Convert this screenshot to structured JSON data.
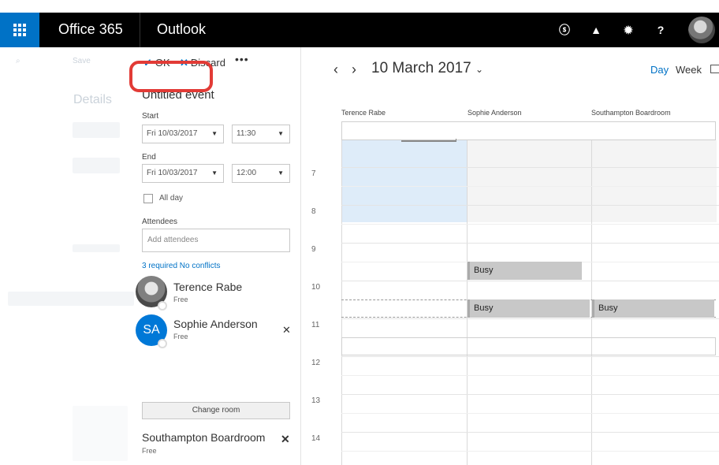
{
  "topbar": {
    "suite_title": "Office 365",
    "app_title": "Outlook",
    "icons": [
      "app-launcher-icon",
      "skype-icon",
      "bell-icon",
      "gear-icon",
      "help-icon",
      "user-avatar"
    ],
    "skype_glyph": "ⓢ",
    "bell_glyph": "▲",
    "gear_glyph": "✹",
    "help_glyph": "?"
  },
  "toolbar": {
    "ok_label": "OK",
    "discard_label": "Discard",
    "more_label": "•••"
  },
  "event": {
    "subject": "Untitled event",
    "start_label": "Start",
    "start_date": "Fri 10/03/2017",
    "start_time": "11:30",
    "end_label": "End",
    "end_date": "Fri 10/03/2017",
    "end_time": "12:00",
    "all_day_label": "All day",
    "attendees_label": "Attendees",
    "attendees_placeholder": "Add attendees",
    "conflicts_text": "3 required No conflicts",
    "attendees": [
      {
        "name": "Terence Rabe",
        "status": "Free"
      },
      {
        "name": "Sophie Anderson",
        "initials": "SA",
        "status": "Free"
      }
    ],
    "change_room_label": "Change room",
    "room": {
      "name": "Southampton Boardroom",
      "status": "Free"
    }
  },
  "calendar": {
    "date_label": "10 March 2017",
    "view_day": "Day",
    "view_week": "Week",
    "columns": [
      "Terence Rabe",
      "Sophie Anderson",
      "Southampton Boardroom"
    ],
    "hours": [
      "7",
      "8",
      "9",
      "10",
      "11",
      "12",
      "13",
      "14"
    ],
    "busy_label": "Busy"
  },
  "background": {
    "save_label": "Save",
    "details_label": "Details"
  },
  "colors": {
    "accent": "#0072c6",
    "highlight": "#e23b36",
    "busy": "#c8c8c8",
    "selected_slot": "#deecf9"
  }
}
